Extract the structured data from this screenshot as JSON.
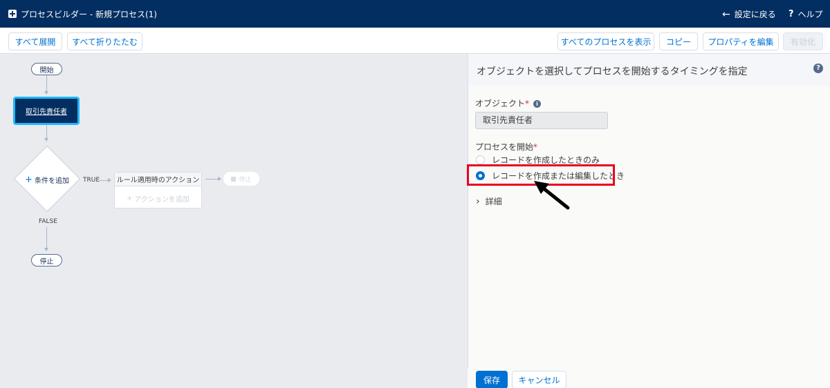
{
  "topbar": {
    "app_icon": "process-builder-icon",
    "title": "プロセスビルダー - 新規プロセス(1)",
    "back_label": "設定に戻る",
    "help_label": "ヘルプ"
  },
  "toolbar": {
    "expand_all": "すべて展開",
    "collapse_all": "すべて折りたたむ",
    "show_all_processes": "すべてのプロセスを表示",
    "copy": "コピー",
    "edit_properties": "プロパティを編集",
    "activate": "有効化"
  },
  "canvas": {
    "start_label": "開始",
    "object_node": "取引先責任者",
    "add_criteria": "条件を追加",
    "true_label": "TRUE",
    "false_label": "FALSE",
    "action_header": "ルール適用時のアクション",
    "add_action": "アクションを追加",
    "stop_disabled": "停止",
    "stop_label": "停止"
  },
  "panel": {
    "title": "オブジェクトを選択してプロセスを開始するタイミングを指定",
    "object_label": "オブジェクト",
    "object_value": "取引先責任者",
    "start_label": "プロセスを開始",
    "options": [
      {
        "label": "レコードを作成したときのみ",
        "selected": false
      },
      {
        "label": "レコードを作成または編集したとき",
        "selected": true
      }
    ],
    "details_label": "詳細",
    "save": "保存",
    "cancel": "キャンセル"
  },
  "colors": {
    "header_bg": "#032e61",
    "brand_blue": "#0070d2",
    "highlight_red": "#e8001c",
    "node_border": "#1fb6ff"
  }
}
